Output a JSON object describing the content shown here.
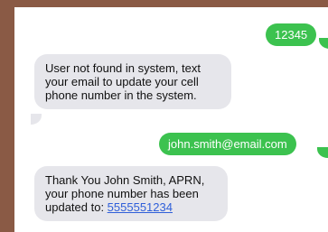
{
  "messages": [
    {
      "direction": "sent",
      "text": "12345"
    },
    {
      "direction": "received",
      "text": "User not found in system, text your email to update your cell phone number in the system."
    },
    {
      "direction": "sent",
      "text": "john.smith@email.com"
    },
    {
      "direction": "received",
      "text_prefix": "Thank You John Smith, APRN, your phone number has been updated to: ",
      "link_text": "5555551234"
    }
  ],
  "colors": {
    "sent_bubble": "#3cc24f",
    "received_bubble": "#e6e6eb",
    "link": "#2f5fd9",
    "frame_border": "#8a5a45"
  }
}
